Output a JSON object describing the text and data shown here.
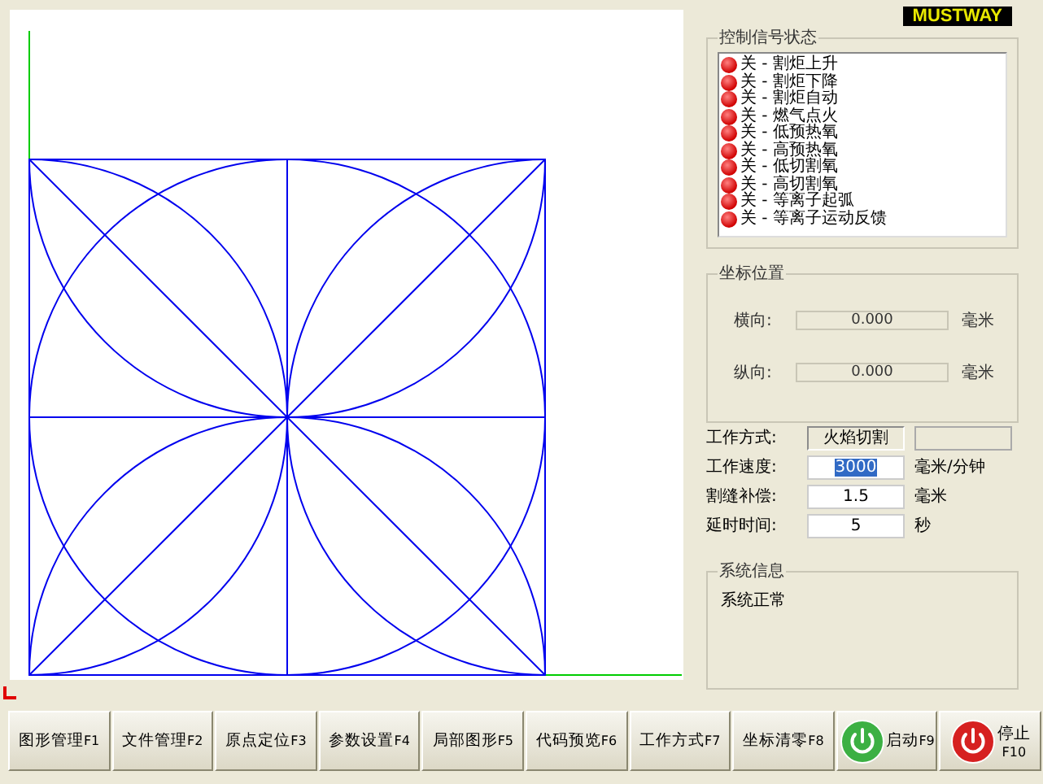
{
  "logo": "MUSTWAY",
  "signals": {
    "title": "控制信号状态",
    "items": [
      {
        "label": "关 - 割炬上升",
        "on": false
      },
      {
        "label": "关 - 割炬下降",
        "on": false
      },
      {
        "label": "关 - 割炬自动",
        "on": false
      },
      {
        "label": "关 - 燃气点火",
        "on": false
      },
      {
        "label": "关 - 低预热氧",
        "on": false
      },
      {
        "label": "关 - 高预热氧",
        "on": false
      },
      {
        "label": "关 - 低切割氧",
        "on": false
      },
      {
        "label": "关 - 高切割氧",
        "on": false
      },
      {
        "label": "关 - 等离子起弧",
        "on": false
      },
      {
        "label": "关 - 等离子运动反馈",
        "on": false
      }
    ]
  },
  "position": {
    "title": "坐标位置",
    "rows": [
      {
        "label": "横向:",
        "value": "0.000",
        "unit": "毫米"
      },
      {
        "label": "纵向:",
        "value": "0.000",
        "unit": "毫米"
      }
    ]
  },
  "work_mode": {
    "label": "工作方式:",
    "value": "火焰切割"
  },
  "params": [
    {
      "label": "工作速度:",
      "value": "3000",
      "unit": "毫米/分钟",
      "selected": true
    },
    {
      "label": "割缝补偿:",
      "value": "1.5",
      "unit": "毫米",
      "selected": false
    },
    {
      "label": "延时时间:",
      "value": "5",
      "unit": "秒",
      "selected": false
    }
  ],
  "system_info": {
    "title": "系统信息",
    "message": "系统正常"
  },
  "buttons": [
    {
      "kind": "plain",
      "label": "图形管理",
      "key": "F1"
    },
    {
      "kind": "plain",
      "label": "文件管理",
      "key": "F2"
    },
    {
      "kind": "plain",
      "label": "原点定位",
      "key": "F3"
    },
    {
      "kind": "plain",
      "label": "参数设置",
      "key": "F4"
    },
    {
      "kind": "plain",
      "label": "局部图形",
      "key": "F5"
    },
    {
      "kind": "plain",
      "label": "代码预览",
      "key": "F6"
    },
    {
      "kind": "plain",
      "label": "工作方式",
      "key": "F7"
    },
    {
      "kind": "plain",
      "label": "坐标清零",
      "key": "F8"
    },
    {
      "kind": "start",
      "label": "启动",
      "key": "F9"
    },
    {
      "kind": "stop",
      "label": "停止",
      "key": "F10"
    }
  ]
}
